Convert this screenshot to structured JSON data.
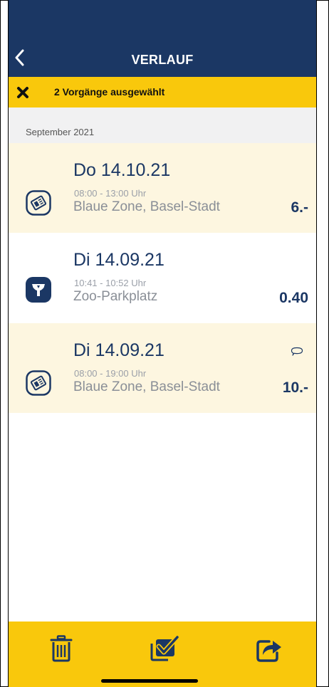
{
  "header": {
    "title": "VERLAUF"
  },
  "selection": {
    "text": "2 Vorgänge ausgewählt"
  },
  "section": {
    "label": "September 2021"
  },
  "entries": [
    {
      "date": "Do 14.10.21",
      "time": "08:00 - 13:00 Uhr",
      "place": "Blaue Zone, Basel-Stadt",
      "amount": "6.-",
      "icon": "parking-disc-icon",
      "selected": true
    },
    {
      "date": "Di 14.09.21",
      "time": "10:41 - 10:52 Uhr",
      "place": "Zoo-Parkplatz",
      "amount": "0.40",
      "icon": "parking-meter-icon",
      "selected": false
    },
    {
      "date": "Di 14.09.21",
      "time": "08:00 - 19:00 Uhr",
      "place": "Blaue Zone, Basel-Stadt",
      "amount": "10.-",
      "icon": "parking-disc-icon",
      "selected": true,
      "comment_icon": "comment-icon"
    }
  ],
  "toolbar": {
    "icons": [
      "trash-icon",
      "select-all-icon",
      "share-icon"
    ]
  },
  "colors": {
    "navy": "#1b3764",
    "yellow": "#f9c80c",
    "selected_bg": "#fdf6e0"
  }
}
